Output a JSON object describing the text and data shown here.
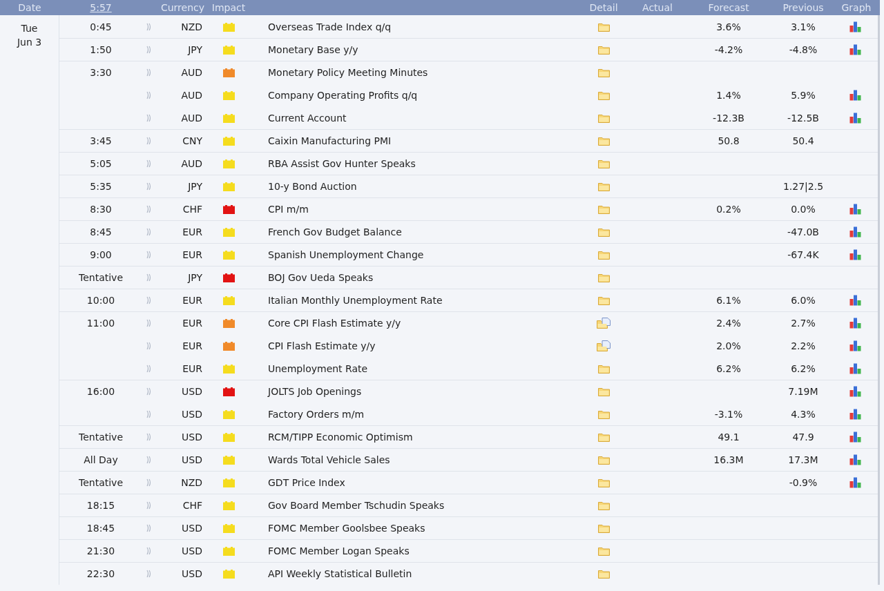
{
  "columns": {
    "date": "Date",
    "time": "5:57",
    "currency": "Currency",
    "impact": "Impact",
    "detail": "Detail",
    "actual": "Actual",
    "forecast": "Forecast",
    "previous": "Previous",
    "graph": "Graph"
  },
  "day": {
    "weekday": "Tue",
    "date": "Jun 3"
  },
  "rows": [
    {
      "time": "0:45",
      "currency": "NZD",
      "color": "#f5dc1e",
      "event": "Overseas Trade Index q/q",
      "preview": false,
      "forecast": "3.6%",
      "previous": "3.1%",
      "graph": true
    },
    {
      "time": "1:50",
      "currency": "JPY",
      "color": "#f5dc1e",
      "event": "Monetary Base y/y",
      "preview": false,
      "forecast": "-4.2%",
      "previous": "-4.8%",
      "graph": true
    },
    {
      "time": "3:30",
      "currency": "AUD",
      "color": "#f08a2a",
      "event": "Monetary Policy Meeting Minutes",
      "preview": false,
      "graph": false
    },
    {
      "currency": "AUD",
      "color": "#f5dc1e",
      "event": "Company Operating Profits q/q",
      "preview": false,
      "forecast": "1.4%",
      "previous": "5.9%",
      "graph": true
    },
    {
      "currency": "AUD",
      "color": "#f5dc1e",
      "event": "Current Account",
      "preview": false,
      "forecast": "-12.3B",
      "previous": "-12.5B",
      "graph": true
    },
    {
      "time": "3:45",
      "currency": "CNY",
      "color": "#f5dc1e",
      "event": "Caixin Manufacturing PMI",
      "preview": false,
      "forecast": "50.8",
      "previous": "50.4",
      "graph": false
    },
    {
      "time": "5:05",
      "currency": "AUD",
      "color": "#f5dc1e",
      "event": "RBA Assist Gov Hunter Speaks",
      "preview": false,
      "graph": false
    },
    {
      "time": "5:35",
      "currency": "JPY",
      "color": "#f5dc1e",
      "event": "10-y Bond Auction",
      "preview": false,
      "previous": "1.27|2.5",
      "graph": false
    },
    {
      "time": "8:30",
      "currency": "CHF",
      "color": "#e21313",
      "event": "CPI m/m",
      "preview": false,
      "forecast": "0.2%",
      "previous": "0.0%",
      "graph": true
    },
    {
      "time": "8:45",
      "currency": "EUR",
      "color": "#f5dc1e",
      "event": "French Gov Budget Balance",
      "preview": false,
      "previous": "-47.0B",
      "graph": true
    },
    {
      "time": "9:00",
      "currency": "EUR",
      "color": "#f5dc1e",
      "event": "Spanish Unemployment Change",
      "preview": false,
      "previous": "-67.4K",
      "graph": true
    },
    {
      "time": "Tentative",
      "currency": "JPY",
      "color": "#e21313",
      "event": "BOJ Gov Ueda Speaks",
      "preview": false,
      "graph": false
    },
    {
      "time": "10:00",
      "currency": "EUR",
      "color": "#f5dc1e",
      "event": "Italian Monthly Unemployment Rate",
      "preview": false,
      "forecast": "6.1%",
      "previous": "6.0%",
      "graph": true
    },
    {
      "time": "11:00",
      "currency": "EUR",
      "color": "#f08a2a",
      "event": "Core CPI Flash Estimate y/y",
      "preview": true,
      "forecast": "2.4%",
      "previous": "2.7%",
      "graph": true
    },
    {
      "currency": "EUR",
      "color": "#f08a2a",
      "event": "CPI Flash Estimate y/y",
      "preview": true,
      "forecast": "2.0%",
      "previous": "2.2%",
      "graph": true
    },
    {
      "currency": "EUR",
      "color": "#f5dc1e",
      "event": "Unemployment Rate",
      "preview": false,
      "forecast": "6.2%",
      "previous": "6.2%",
      "graph": true
    },
    {
      "time": "16:00",
      "currency": "USD",
      "color": "#e21313",
      "event": "JOLTS Job Openings",
      "preview": false,
      "previous": "7.19M",
      "graph": true
    },
    {
      "currency": "USD",
      "color": "#f5dc1e",
      "event": "Factory Orders m/m",
      "preview": false,
      "forecast": "-3.1%",
      "previous": "4.3%",
      "graph": true
    },
    {
      "time": "Tentative",
      "currency": "USD",
      "color": "#f5dc1e",
      "event": "RCM/TIPP Economic Optimism",
      "preview": false,
      "forecast": "49.1",
      "previous": "47.9",
      "graph": true
    },
    {
      "time": "All Day",
      "currency": "USD",
      "color": "#f5dc1e",
      "event": "Wards Total Vehicle Sales",
      "preview": false,
      "forecast": "16.3M",
      "previous": "17.3M",
      "graph": true
    },
    {
      "time": "Tentative",
      "currency": "NZD",
      "color": "#f5dc1e",
      "event": "GDT Price Index",
      "preview": false,
      "previous": "-0.9%",
      "graph": true
    },
    {
      "time": "18:15",
      "currency": "CHF",
      "color": "#f5dc1e",
      "event": "Gov Board Member Tschudin Speaks",
      "preview": false,
      "graph": false
    },
    {
      "time": "18:45",
      "currency": "USD",
      "color": "#f5dc1e",
      "event": "FOMC Member Goolsbee Speaks",
      "preview": false,
      "graph": false
    },
    {
      "time": "21:30",
      "currency": "USD",
      "color": "#f5dc1e",
      "event": "FOMC Member Logan Speaks",
      "preview": false,
      "graph": false
    },
    {
      "time": "22:30",
      "currency": "USD",
      "color": "#f5dc1e",
      "event": "API Weekly Statistical Bulletin",
      "preview": false,
      "graph": false
    }
  ]
}
